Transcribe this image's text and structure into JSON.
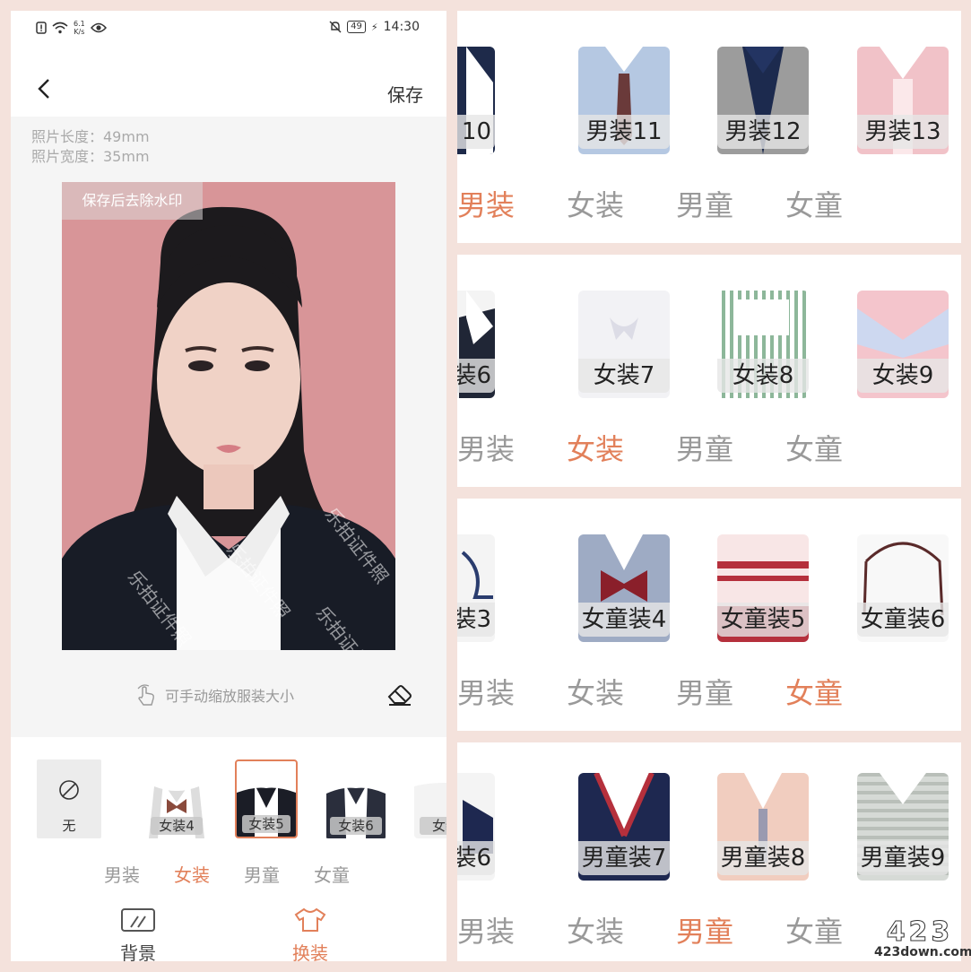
{
  "status": {
    "speed_top": "6.1",
    "speed_unit": "K/s",
    "battery": "49",
    "time": "14:30"
  },
  "header": {
    "save_label": "保存"
  },
  "specs": {
    "length": "照片长度：49mm",
    "width": "照片宽度：35mm"
  },
  "photo": {
    "watermark_tag": "保存后去除水印",
    "watermark_text": "乐拍证件照",
    "background_color": "#d89598"
  },
  "hint": "可手动缩放服装大小",
  "outfits": {
    "none_label": "无",
    "items": [
      {
        "label": "女装4"
      },
      {
        "label": "女装5",
        "selected": true
      },
      {
        "label": "女装6"
      },
      {
        "label": "女装"
      }
    ]
  },
  "categories": [
    "男装",
    "女装",
    "男童",
    "女童"
  ],
  "bottom_tabs": [
    {
      "label": "背景"
    },
    {
      "label": "换装",
      "active": true
    }
  ],
  "right_panels": [
    {
      "items": [
        "10",
        "男装11",
        "男装12",
        "男装13"
      ],
      "active_tab": 0
    },
    {
      "items": [
        "装6",
        "女装7",
        "女装8",
        "女装9"
      ],
      "active_tab": 1
    },
    {
      "items": [
        "装3",
        "女童装4",
        "女童装5",
        "女童装6"
      ],
      "active_tab": 3
    },
    {
      "items": [
        "装6",
        "男童装7",
        "男童装8",
        "男童装9"
      ],
      "active_tab": 2
    }
  ],
  "logo": {
    "big": "423",
    "small": "423down.com"
  },
  "colors": {
    "accent": "#e2805a",
    "muted": "#999999"
  }
}
